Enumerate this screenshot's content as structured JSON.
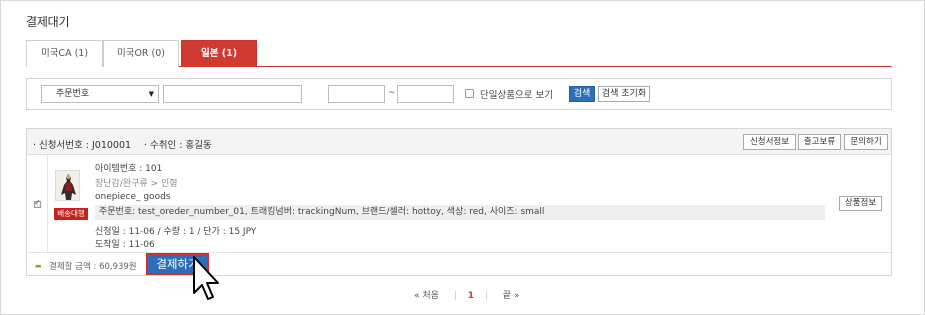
{
  "page": {
    "title": "결제대기"
  },
  "tabs": [
    {
      "label": "미국CA (1)",
      "active": false
    },
    {
      "label": "미국OR (0)",
      "active": false
    },
    {
      "label": "일본 (1)",
      "active": true
    }
  ],
  "search": {
    "select_value": "주문번호",
    "keyword_value": "",
    "date_from": "",
    "date_to": "",
    "range_sep": "~",
    "single_product_label": "단일상품으로 보기",
    "search_button": "검색",
    "reset_button": "검색 초기화"
  },
  "order": {
    "request_no": "· 신청서번호 : J010001",
    "receiver": "· 수취인 : 홍길동",
    "buttons": {
      "request_info": "신청서정보",
      "hold": "출고보류",
      "inquiry": "문의하기"
    },
    "item": {
      "item_no": "아이템번호 : 101",
      "category": "장난감/완구류 > 인형",
      "name": "onepiece_ goods",
      "options": "주문번호: test_oreder_number_01, 트래킹넘버: trackingNum, 브랜드/셀러: hottoy, 색상: red, 사이즈: small",
      "request_detail": "신청일 : 11-06 / 수량 : 1 / 단가 : 15 JPY",
      "arrival": "도착일 : 11-06",
      "badge": "배송대행",
      "product_info_button": "상품정보"
    },
    "footer": {
      "amount": "결제할 금액 : 60,939원",
      "pay_button": "결제하기"
    }
  },
  "pagination": {
    "first": "« 처음",
    "current": "1",
    "last": "끝 »"
  },
  "colors": {
    "accent_red": "#d03a30",
    "accent_blue": "#2c6fb8",
    "badge_red": "#c91f1f"
  }
}
